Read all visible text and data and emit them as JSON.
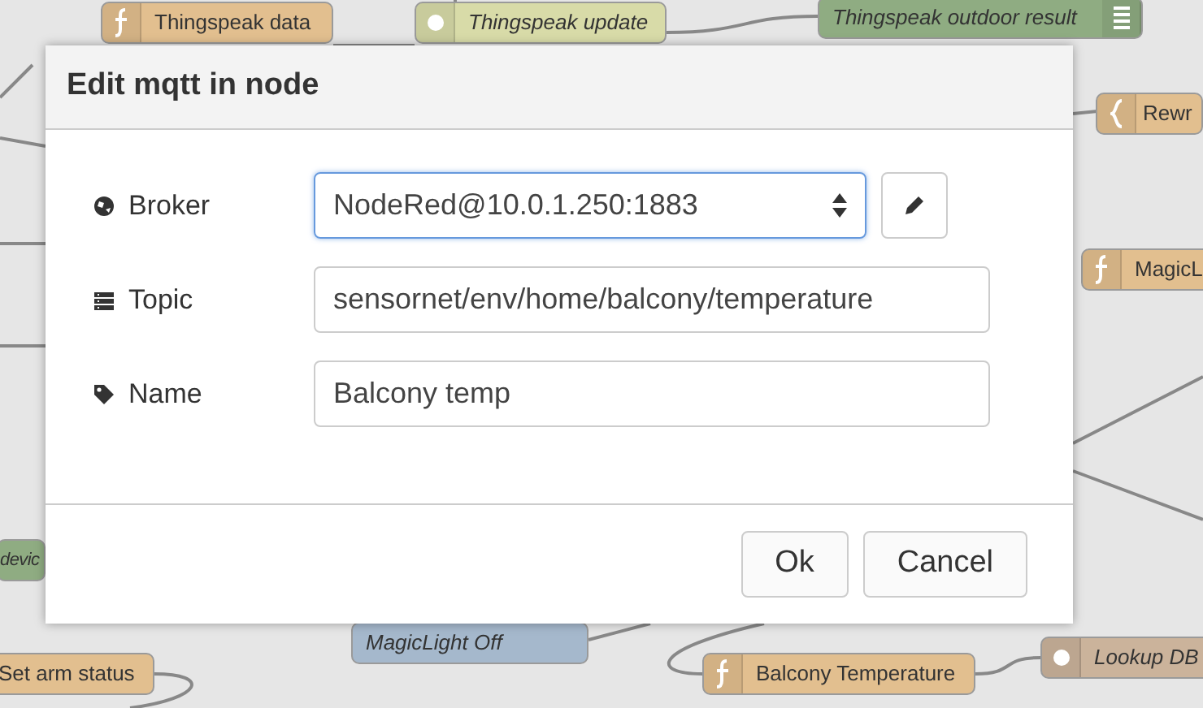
{
  "canvas": {
    "nodes": [
      {
        "label": "Thingspeak data",
        "color": "#e2bf8f",
        "italic": false
      },
      {
        "label": "Thingspeak update",
        "color": "#d8dba8",
        "italic": true
      },
      {
        "label": "Thingspeak outdoor result",
        "color": "#8fac82",
        "italic": true
      },
      {
        "label": "Rewr",
        "color": "#e2bf8f",
        "italic": false
      },
      {
        "label": "MagicL",
        "color": "#e2bf8f",
        "italic": false
      },
      {
        "label": "devic",
        "color": "#8fac82",
        "italic": true
      },
      {
        "label": "MagicLight Off",
        "color": "#a5b8cc",
        "italic": true
      },
      {
        "label": "Set arm status",
        "color": "#e2bf8f",
        "italic": false
      },
      {
        "label": "Balcony Temperature",
        "color": "#e2bf8f",
        "italic": false
      },
      {
        "label": "Lookup DB",
        "color": "#cbb39b",
        "italic": true
      }
    ]
  },
  "dialog": {
    "title": "Edit mqtt in node",
    "fields": [
      {
        "label": "Broker",
        "kind": "select",
        "value": "NodeRed@10.0.1.250:1883",
        "focused": true
      },
      {
        "label": "Topic",
        "kind": "text",
        "value": "sensornet/env/home/balcony/temperature",
        "focused": false
      },
      {
        "label": "Name",
        "kind": "text",
        "value": "Balcony temp",
        "focused": false
      }
    ],
    "buttons": [
      {
        "label": "Ok"
      },
      {
        "label": "Cancel"
      }
    ]
  }
}
